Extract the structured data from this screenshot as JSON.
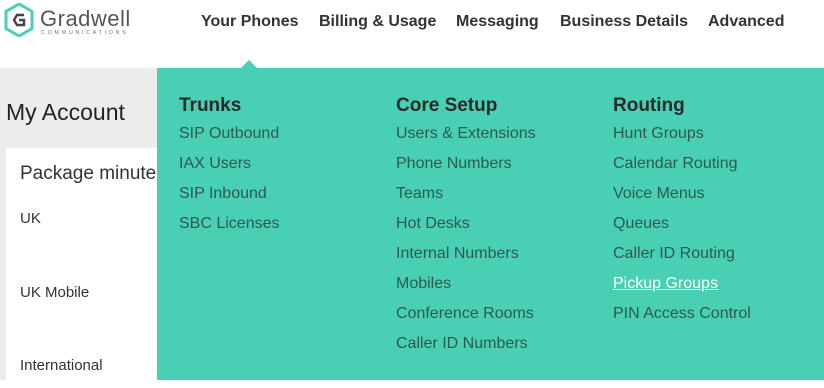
{
  "brand": {
    "name": "Gradwell",
    "tagline": "COMMUNICATIONS",
    "accent": "#49cfb3"
  },
  "nav": {
    "items": [
      "Your Phones",
      "Billing & Usage",
      "Messaging",
      "Business Details",
      "Advanced"
    ]
  },
  "page": {
    "title": "My Account",
    "card_title": "Package minute",
    "rows": [
      "UK",
      "UK Mobile",
      "International"
    ]
  },
  "menu": {
    "columns": [
      {
        "heading": "Trunks",
        "items": [
          "SIP Outbound",
          "IAX Users",
          "SIP Inbound",
          "SBC Licenses"
        ]
      },
      {
        "heading": "Core Setup",
        "items": [
          "Users & Extensions",
          "Phone Numbers",
          "Teams",
          "Hot Desks",
          "Internal Numbers",
          "Mobiles",
          "Conference Rooms",
          "Caller ID Numbers"
        ]
      },
      {
        "heading": "Routing",
        "items": [
          "Hunt Groups",
          "Calendar Routing",
          "Voice Menus",
          "Queues",
          "Caller ID Routing",
          "Pickup Groups",
          "PIN Access Control"
        ]
      }
    ],
    "active_item": "Pickup Groups"
  }
}
